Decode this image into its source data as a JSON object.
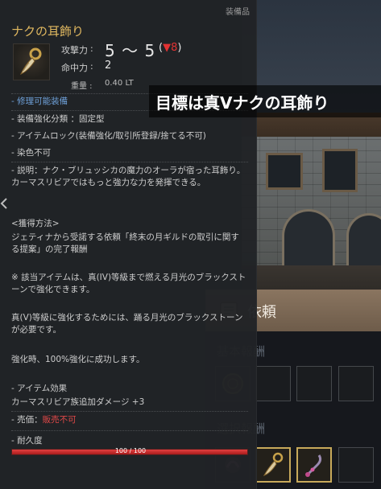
{
  "caption": "目標は真Vナクの耳飾り",
  "tooltip": {
    "category": "装備品",
    "title": "ナクの耳飾り",
    "icon": "earring-icon",
    "stats": {
      "attack_label": "攻撃力",
      "attack_value": "5 ～ 5",
      "attack_diff_open": "(",
      "attack_diff_arrow": "▼",
      "attack_diff_value": "8",
      "attack_diff_close": ")",
      "hit_label": "命中力",
      "hit_value": "2",
      "weight_label": "重量 :",
      "weight_value": "0.40 LT",
      "separator": ":"
    },
    "repairable": "- 修理可能装備",
    "enhance_type": "- 装備強化分類 ：固定型",
    "item_lock": "- アイテムロック(装備強化/取引所登録/捨てる不可)",
    "no_dye": "- 染色不可",
    "description": "- 説明：ナク・ブリュッシカの魔力のオーラが宿った耳飾り。カーマスリビアではもっと強力な力を発揮できる。",
    "acquire_header": "<獲得方法>",
    "acquire_text": "ジェティナから受諾する依頼「終末の月ギルドの取引に関する提案」の完了報酬",
    "note1": "※ 該当アイテムは、真(IV)等級まで燃える月光のブラックストーンで強化できます。",
    "note2": "真(V)等級に強化するためには、踊る月光のブラックストーンが必要です。",
    "note3": "強化時、100%強化に成功します。",
    "effect_header": "- アイテム効果",
    "effect_text": "カーマスリビア族追加ダメージ +3",
    "sell_label": "- 売価：",
    "sell_value": "販売不可",
    "durability_label": "- 耐久度",
    "durability_text": "100 / 100",
    "durability_fraction": 1.0
  },
  "quest": {
    "title": "依頼",
    "basic_reward": "基本報酬",
    "select_reward": "選択報酬",
    "icon": "quest-scroll-icon"
  },
  "colors": {
    "title_gold": "#e0b860",
    "accent_blue": "#6ea0d8",
    "negative_red": "#e23232",
    "durability_red": "#d83030"
  }
}
